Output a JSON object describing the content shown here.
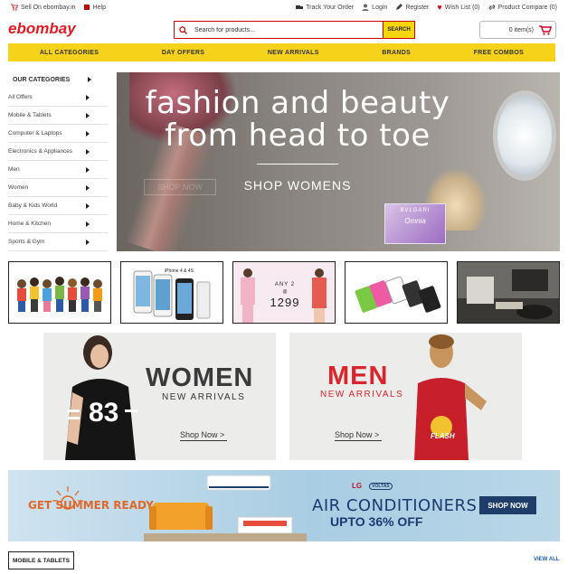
{
  "topbar": {
    "sell": "Sell On ebombay.in",
    "help": "Help",
    "track": "Track Your Order",
    "login": "Login",
    "register": "Register",
    "wishlist": "Wish List (0)",
    "compare": "Product Compare (0)"
  },
  "header": {
    "logo_part1": "e",
    "logo_part2": "bombay",
    "search_placeholder": "Search for products...",
    "search_button": "SEARCH",
    "cart_label": "0 item(s)"
  },
  "nav": [
    "ALL CATEGORIES",
    "DAY OFFERS",
    "NEW ARRIVALS",
    "BRANDS",
    "FREE COMBOS"
  ],
  "categories": {
    "title": "OUR CATEGORIES",
    "items": [
      "All Offers",
      "Mobile & Tablets",
      "Computer & Laptops",
      "Electronics & Appliances",
      "Men",
      "Women",
      "Baby & Kids World",
      "Home & Kitchen",
      "Sports & Gym"
    ]
  },
  "hero": {
    "headline": "fashion and beauty from head to toe",
    "cta": "SHOP WOMENS",
    "ghost_cta": "SHOP NOW",
    "perfume_brand": "BVLGARI",
    "perfume_name": "Omnia"
  },
  "thumbs": {
    "phone_label": "iPhone 4 & 4S",
    "promo_top": "ANY 2",
    "promo_at": "@",
    "promo_price": "1299"
  },
  "arrivals": {
    "women": {
      "title": "WOMEN",
      "sub": "NEW ARRIVALS",
      "cta": "Shop Now >",
      "shirt_number": "83"
    },
    "men": {
      "title": "MEN",
      "sub": "NEW ARRIVALS",
      "cta": "Shop Now >",
      "shirt_text": "FLASH"
    }
  },
  "ac_banner": {
    "left": "GET SUMMER READY",
    "brand1": "LG",
    "brand2": "VOLTAS",
    "title": "AIR CONDITIONERS",
    "sub": "UPTO 36% OFF",
    "cta": "SHOP NOW"
  },
  "section": {
    "tab": "MOBILE & TABLETS",
    "view_all": "VIEW ALL"
  },
  "colors": {
    "brand_red": "#e31b23",
    "nav_yellow": "#f6d21b",
    "link_blue": "#1f5fb8",
    "ac_navy": "#1f3d6b"
  }
}
